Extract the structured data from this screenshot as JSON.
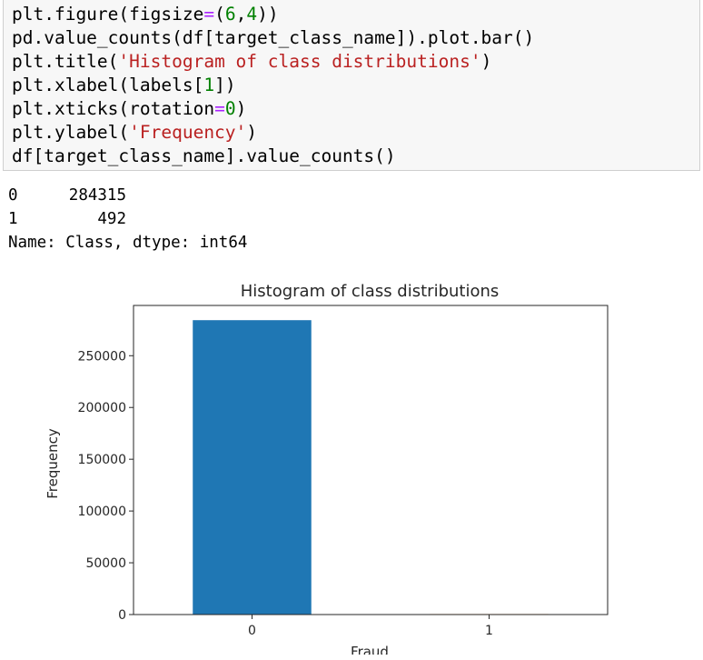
{
  "code": {
    "lines": [
      [
        {
          "t": "plt.figure(figsize"
        },
        {
          "t": "=",
          "c": "op"
        },
        {
          "t": "("
        },
        {
          "t": "6",
          "c": "num"
        },
        {
          "t": ","
        },
        {
          "t": "4",
          "c": "num"
        },
        {
          "t": "))"
        }
      ],
      [
        {
          "t": "pd.value_counts(df[target_class_name]).plot.bar()"
        }
      ],
      [
        {
          "t": "plt.title("
        },
        {
          "t": "'Histogram of class distributions'",
          "c": "str"
        },
        {
          "t": ")"
        }
      ],
      [
        {
          "t": "plt.xlabel(labels["
        },
        {
          "t": "1",
          "c": "num"
        },
        {
          "t": "])"
        }
      ],
      [
        {
          "t": "plt.xticks(rotation"
        },
        {
          "t": "=",
          "c": "op"
        },
        {
          "t": "0",
          "c": "num"
        },
        {
          "t": ")"
        }
      ],
      [
        {
          "t": "plt.ylabel("
        },
        {
          "t": "'Frequency'",
          "c": "str"
        },
        {
          "t": ")"
        }
      ],
      [
        {
          "t": "df[target_class_name].value_counts()"
        }
      ]
    ]
  },
  "output": {
    "value_counts": [
      {
        "index": "0",
        "value": "284315"
      },
      {
        "index": "1",
        "value": "492"
      }
    ],
    "footer": "Name: Class, dtype: int64"
  },
  "chart_data": {
    "type": "bar",
    "title": "Histogram of class distributions",
    "xlabel": "Fraud",
    "ylabel": "Frequency",
    "categories": [
      "0",
      "1"
    ],
    "values": [
      284315,
      492
    ],
    "colors": [
      "#1f77b4",
      "#ff7f0e"
    ],
    "ylim": [
      0,
      298531
    ],
    "yticks": [
      0,
      50000,
      100000,
      150000,
      200000,
      250000
    ],
    "ytick_labels": [
      "0",
      "50000",
      "100000",
      "150000",
      "200000",
      "250000"
    ],
    "grid": false,
    "legend": "none"
  }
}
